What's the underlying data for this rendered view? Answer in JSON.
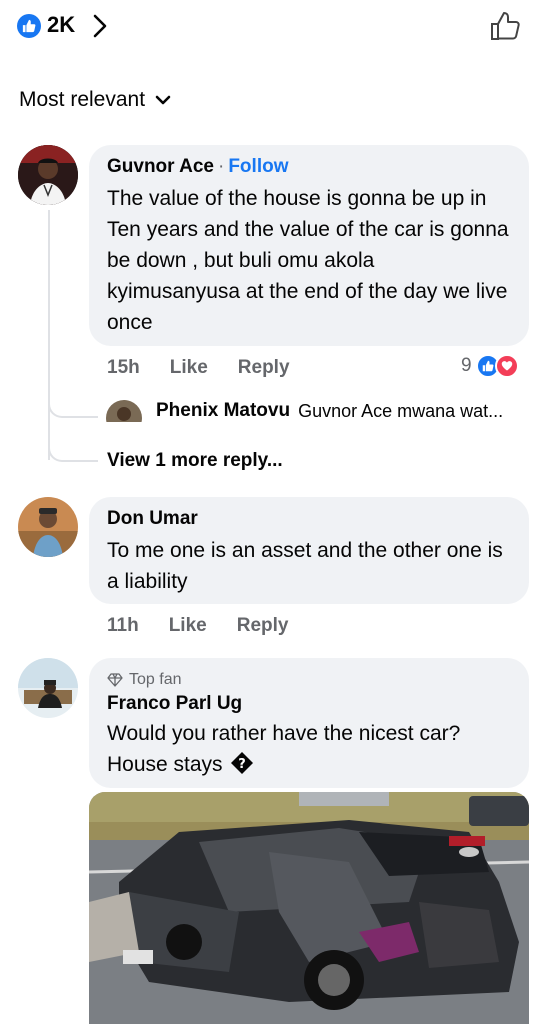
{
  "header": {
    "reaction_count": "2K"
  },
  "sort": {
    "label": "Most relevant"
  },
  "comments": [
    {
      "author": "Guvnor Ace",
      "follow_label": "Follow",
      "text": "The value of the house is gonna be up in Ten years and the value of the car is gonna be down , but buli omu akola kyimusanyusa at the end of the day we live once",
      "time": "15h",
      "like_label": "Like",
      "reply_label": "Reply",
      "reaction_count": "9",
      "reply_preview": {
        "author": "Phenix Matovu",
        "text": "Guvnor Ace mwana wat..."
      },
      "more_replies_label": "View 1 more reply..."
    },
    {
      "author": "Don Umar",
      "text": "To me one is an asset and the other one is a liability",
      "time": "11h",
      "like_label": "Like",
      "reply_label": "Reply"
    },
    {
      "badge": "Top fan",
      "author": "Franco Parl Ug",
      "text": "Would you rather have the nicest car? House stays",
      "text_emoji": "?"
    }
  ],
  "colors": {
    "accent": "#1877f2",
    "bubble": "#f0f2f5",
    "muted": "#65676b",
    "love": "#f33e58"
  }
}
